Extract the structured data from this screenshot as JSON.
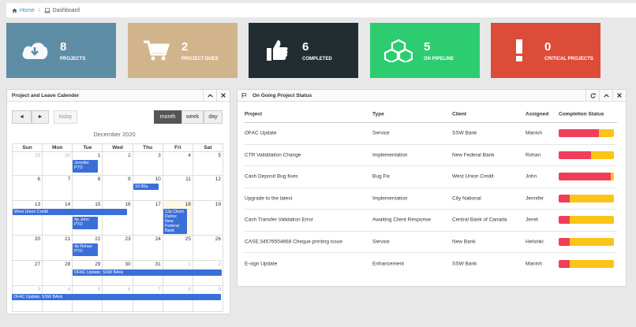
{
  "breadcrumb": {
    "home": "Home",
    "current": "Dashboard"
  },
  "stats": [
    {
      "value": "8",
      "label": "PROJECTS",
      "color": "#5d8ea5",
      "icon": "cloud-download-icon"
    },
    {
      "value": "2",
      "label": "PROJECT DUES",
      "color": "#d2b48c",
      "icon": "cart-icon"
    },
    {
      "value": "6",
      "label": "COMPLETED",
      "color": "#222d32",
      "icon": "thumbs-up-icon"
    },
    {
      "value": "5",
      "label": "ON PIPELINE",
      "color": "#2ecc71",
      "icon": "cubes-icon"
    },
    {
      "value": "0",
      "label": "CRITICAL PROJECTS",
      "color": "#dd4b39",
      "icon": "exclamation-icon"
    }
  ],
  "calendar": {
    "title": "Project and Leave Calender",
    "prev": "◄",
    "next": "►",
    "today": "today",
    "views": [
      "month",
      "week",
      "day"
    ],
    "active_view": "month",
    "month_title": "December 2020",
    "dow": [
      "Sun",
      "Mon",
      "Tue",
      "Wed",
      "Thu",
      "Fri",
      "Sat"
    ],
    "weeks": [
      [
        "29",
        "30",
        "1",
        "2",
        "3",
        "4",
        "5"
      ],
      [
        "6",
        "7",
        "8",
        "9",
        "10",
        "11",
        "12"
      ],
      [
        "13",
        "14",
        "15",
        "16",
        "17",
        "18",
        "19"
      ],
      [
        "20",
        "21",
        "22",
        "23",
        "24",
        "25",
        "26"
      ],
      [
        "27",
        "28",
        "29",
        "30",
        "31",
        "1",
        "2"
      ],
      [
        "3",
        "4",
        "5",
        "6",
        "7",
        "8",
        "9"
      ]
    ],
    "events": {
      "e1": "Jennifer PTO",
      "e2": "10:30a",
      "e3": "West Union Credit",
      "e4": "4p John PTO",
      "e5": "12p Client Demo; New Federal Bank",
      "e6": "4p Rohan PTO",
      "e7": "OFAC Update; SSW BAnk",
      "e8": "OFAC Update; SSW BAnk"
    }
  },
  "projects": {
    "title": "On Going Project Status",
    "columns": [
      "Project",
      "Type",
      "Client",
      "Assigned",
      "Completion Status"
    ],
    "rows": [
      {
        "project": "OFAC Update",
        "type": "Service",
        "client": "SSW Bank",
        "assigned": "Manish",
        "completion": 0.73
      },
      {
        "project": "CTR Validdation Change",
        "type": "Implementation",
        "client": "New Federal Bank",
        "assigned": "Rohan",
        "completion": 0.58
      },
      {
        "project": "Cash Deposit Bug fixes",
        "type": "Bug Fix",
        "client": "West Union Credit",
        "assigned": "John",
        "completion": 0.94
      },
      {
        "project": "Upgrade to the latest",
        "type": "Implementation",
        "client": "City National",
        "assigned": "Jennifer",
        "completion": 0.2
      },
      {
        "project": "Cash Transfer Validation Error",
        "type": "Awaiting Client Response",
        "client": "Central Bank of Canada",
        "assigned": "Jenet",
        "completion": 0.2
      },
      {
        "project": "CASE:34576554668 Cheque printing issue",
        "type": "Service",
        "client": "New Bank",
        "assigned": "Helsinki",
        "completion": 0.2
      },
      {
        "project": "E-sign Update",
        "type": "Enhancement",
        "client": "SSW Bank",
        "assigned": "Manish",
        "completion": 0.2
      }
    ]
  }
}
